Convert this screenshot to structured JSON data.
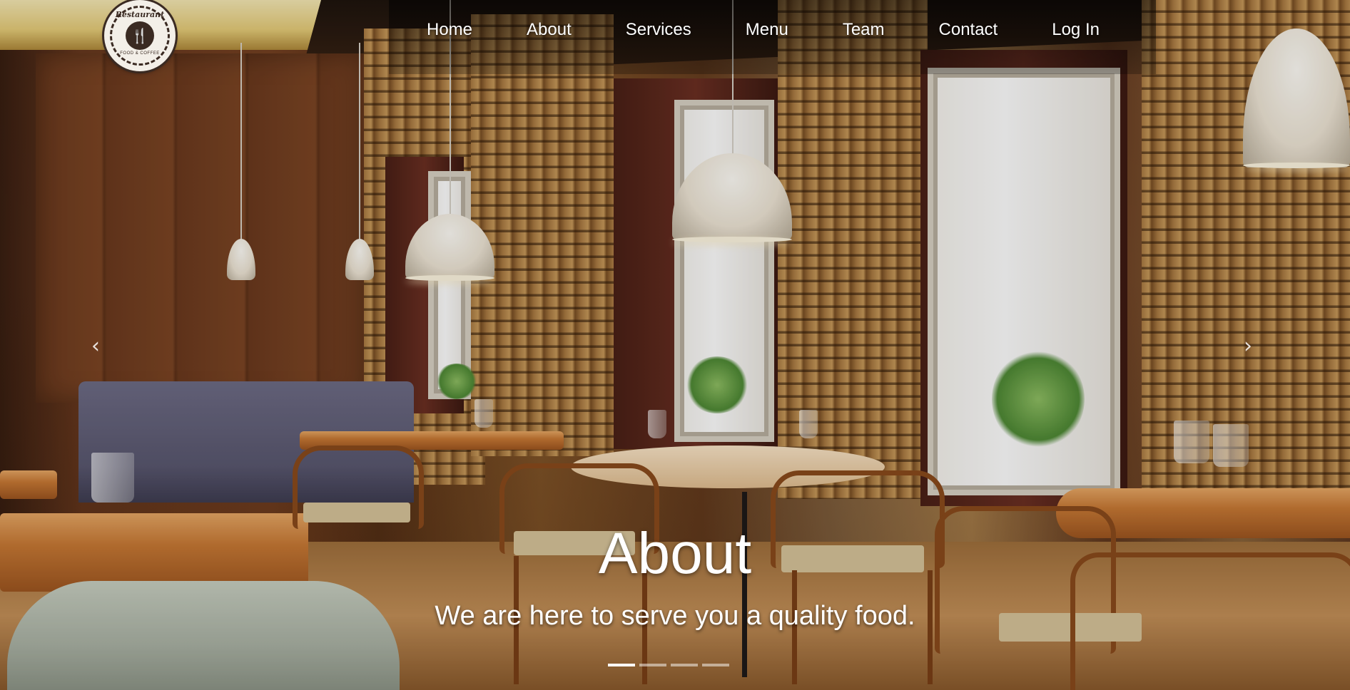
{
  "nav": {
    "logo": {
      "title": "Restaurant",
      "subtitle": "FOOD & COFFEE"
    },
    "links": [
      {
        "label": "Home"
      },
      {
        "label": "About"
      },
      {
        "label": "Services"
      },
      {
        "label": "Menu"
      },
      {
        "label": "Team"
      },
      {
        "label": "Contact"
      },
      {
        "label": "Log In"
      }
    ]
  },
  "carousel": {
    "caption": {
      "title": "About",
      "text": "We are here to serve you a quality food."
    },
    "indicators": {
      "count": 4,
      "active_index": 0
    },
    "controls": {
      "prev_icon": "chevron-left-icon",
      "next_icon": "chevron-right-icon"
    }
  }
}
